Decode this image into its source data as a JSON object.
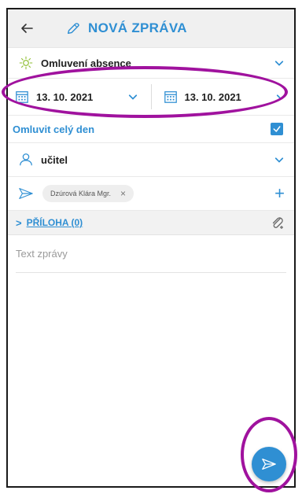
{
  "header": {
    "back_icon": "back-arrow-icon",
    "title_icon": "pencil-icon",
    "title": "NOVÁ ZPRÁVA"
  },
  "reason": {
    "icon": "sun-icon",
    "value": "Omluvení absence"
  },
  "dates": {
    "from": "13. 10. 2021",
    "to": "13. 10. 2021",
    "icon": "calendar-icon"
  },
  "whole_day": {
    "label": "Omluvit celý den",
    "checked": true
  },
  "recipient_type": {
    "icon": "person-icon",
    "value": "učitel"
  },
  "recipients": {
    "icon": "send-icon",
    "chip": "Dzúrová Klára Mgr.",
    "remove": "×",
    "add": "+"
  },
  "attachment": {
    "arrow": ">",
    "label": "PŘÍLOHA (0)",
    "icon": "paperclip-icon"
  },
  "message": {
    "placeholder": "Text zprávy"
  },
  "send_fab": {
    "icon": "send-icon"
  },
  "colors": {
    "accent": "#2f8fd3",
    "annotation": "#a0129e",
    "header_bg": "#f0f0f0"
  }
}
